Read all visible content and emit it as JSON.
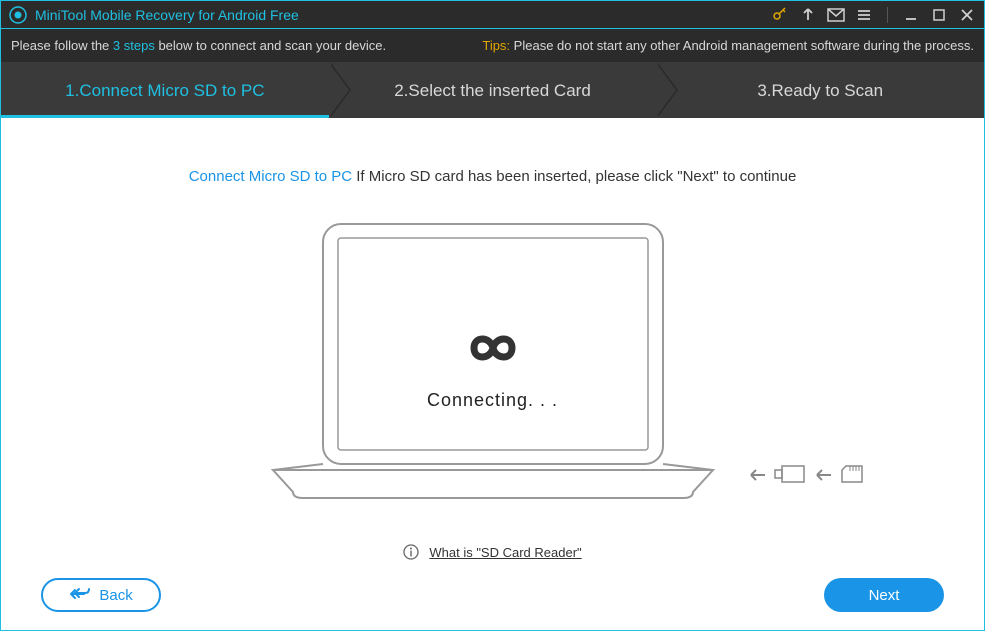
{
  "titlebar": {
    "title": "MiniTool Mobile Recovery for Android Free"
  },
  "infobar": {
    "left_pre": "Please follow the ",
    "left_highlight": "3 steps",
    "left_post": " below to connect and scan your device.",
    "tips_label": "Tips: ",
    "tips_text": "Please do not start any other Android management software during the process."
  },
  "steps": {
    "s1": "1.Connect Micro SD to PC",
    "s2": "2.Select the inserted Card",
    "s3": "3.Ready to Scan"
  },
  "instruction": {
    "link": "Connect Micro SD to PC",
    "rest": " If Micro SD card has been inserted, please click \"Next\" to continue"
  },
  "status": "Connecting. . .",
  "help": {
    "link": "What is \"SD Card Reader\""
  },
  "buttons": {
    "back": "Back",
    "next": "Next"
  }
}
